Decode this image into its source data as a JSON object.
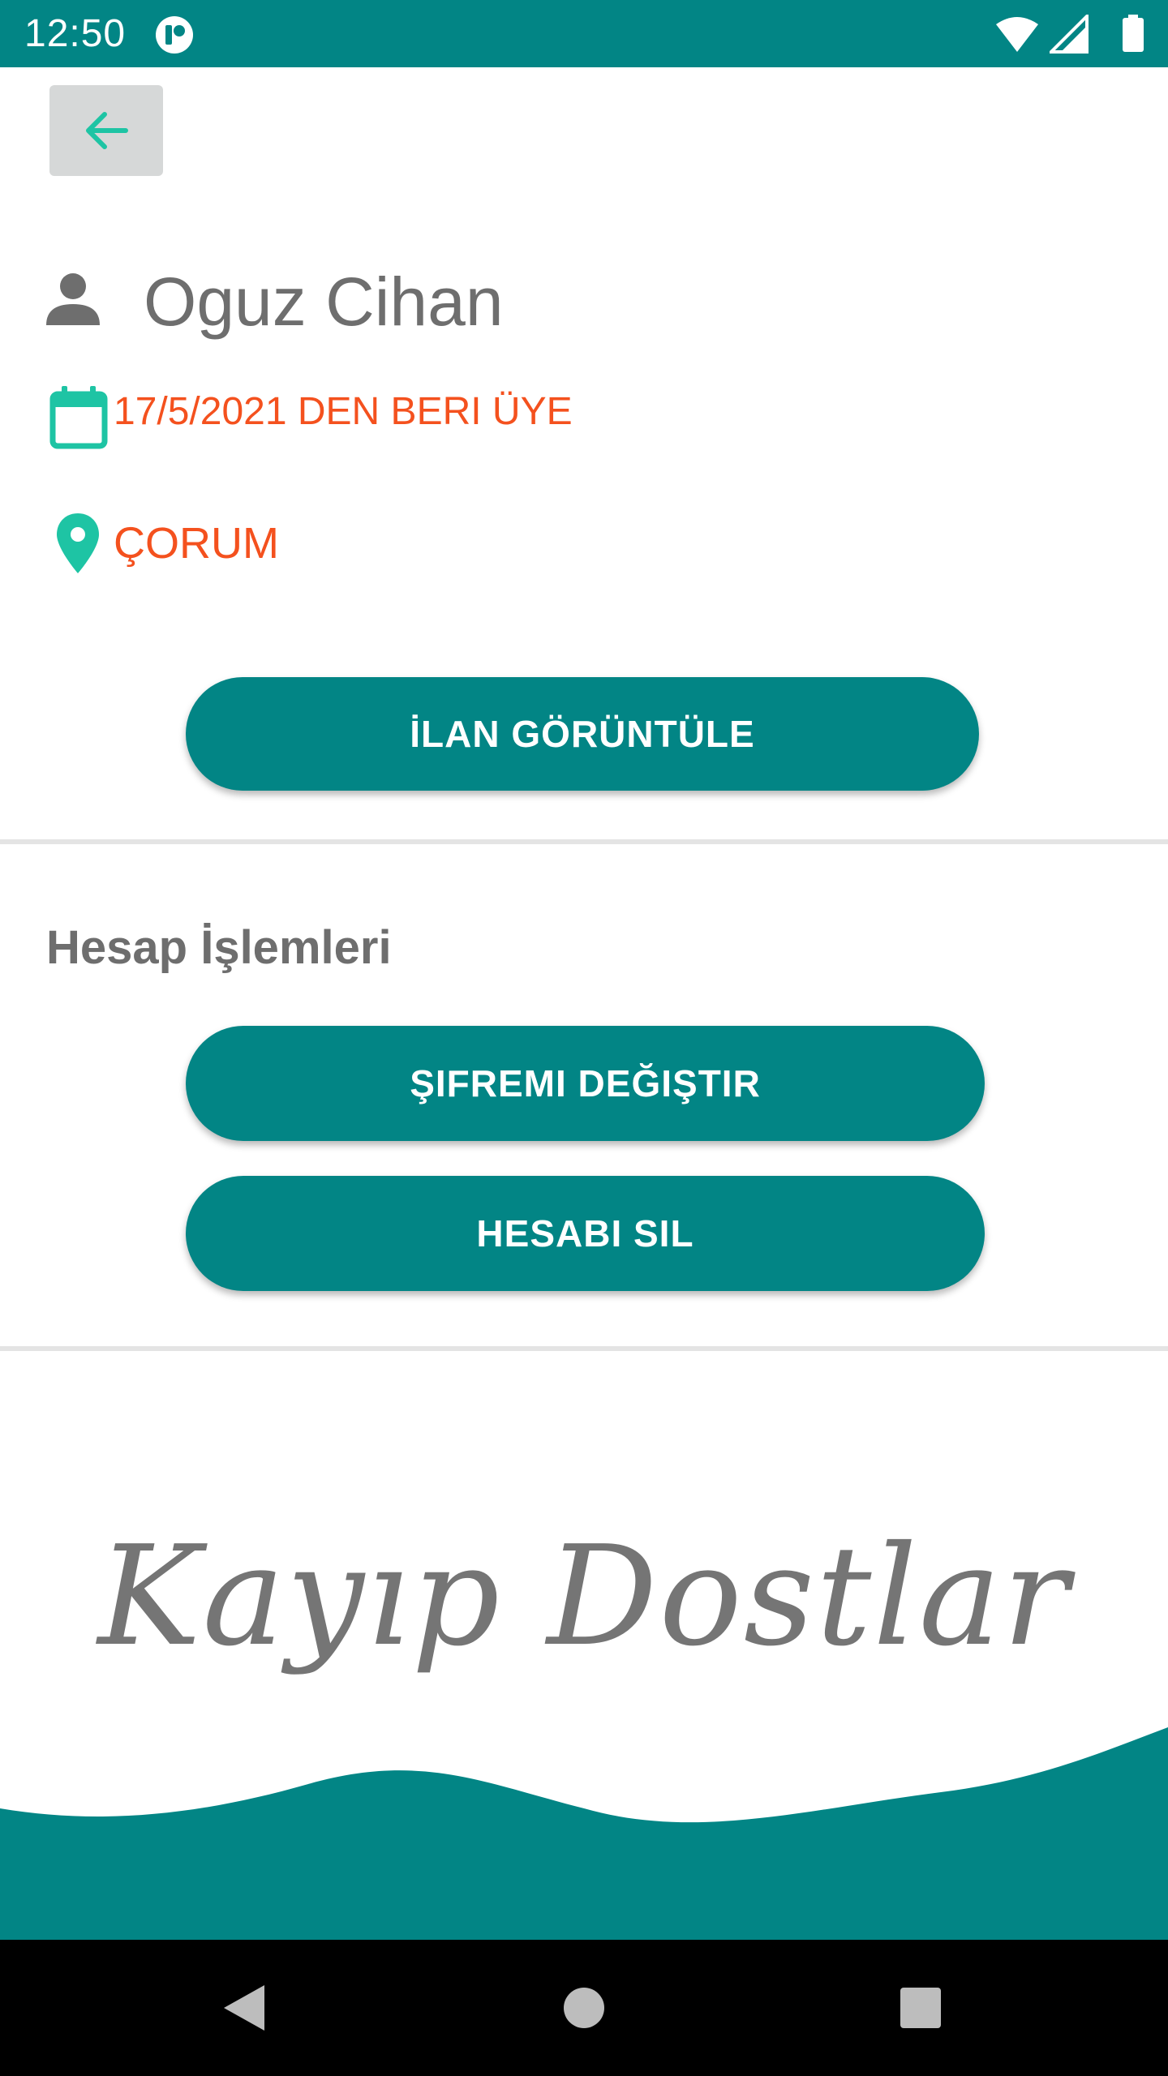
{
  "status_bar": {
    "time": "12:50",
    "icons": [
      "app-notification-icon",
      "wifi-icon",
      "signal-icon",
      "battery-icon"
    ]
  },
  "profile": {
    "name": "Oguz Cihan",
    "member_since": "17/5/2021 DEN BERI ÜYE",
    "location": "ÇORUM"
  },
  "buttons": {
    "view_listings": "İLAN GÖRÜNTÜLE",
    "change_password": "ŞIFREMI DEĞIŞTIR",
    "delete_account": "HESABI SIL"
  },
  "account_section": {
    "title": "Hesap İşlemleri"
  },
  "brand": {
    "text": "Kayıp Dostlar"
  },
  "colors": {
    "primary": "#028585",
    "accent": "#f4511e",
    "icon_teal": "#1ec4a4",
    "text_gray": "#6e6e6e",
    "back_button_bg": "#d6d8d8"
  },
  "nav_bar": {
    "icons": [
      "nav-back-icon",
      "nav-home-icon",
      "nav-recents-icon"
    ]
  }
}
